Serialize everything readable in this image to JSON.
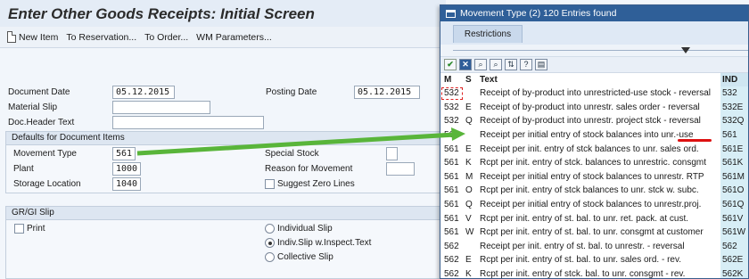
{
  "screen": {
    "title": "Enter Other Goods Receipts: Initial Screen",
    "toolbar": {
      "new_item": "New Item",
      "to_reservation": "To Reservation...",
      "to_order": "To Order...",
      "wm_parameters": "WM Parameters..."
    },
    "header_fields": {
      "document_date_label": "Document Date",
      "document_date_value": "05.12.2015",
      "posting_date_label": "Posting Date",
      "posting_date_value": "05.12.2015",
      "material_slip_label": "Material Slip",
      "material_slip_value": "",
      "doc_header_text_label": "Doc.Header Text",
      "doc_header_text_value": ""
    },
    "defaults": {
      "title": "Defaults for Document Items",
      "movement_type_label": "Movement Type",
      "movement_type_value": "561",
      "plant_label": "Plant",
      "plant_value": "1000",
      "storage_location_label": "Storage Location",
      "storage_location_value": "1040",
      "special_stock_label": "Special Stock",
      "special_stock_value": "",
      "reason_label": "Reason for Movement",
      "reason_value": "",
      "suggest_zero_lines_label": "Suggest Zero Lines"
    },
    "gr_gi_slip": {
      "title": "GR/GI Slip",
      "print_label": "Print",
      "individual_slip": "Individual Slip",
      "indiv_slip_inspect": "Indiv.Slip w.Inspect.Text",
      "collective_slip": "Collective Slip",
      "selected": "indiv_slip_inspect"
    }
  },
  "popup": {
    "title": "Movement Type (2)  120 Entries found",
    "tab": "Restrictions",
    "columns": [
      "M",
      "S",
      "Text",
      "IND"
    ],
    "rows": [
      {
        "m": "532",
        "s": "",
        "text": "Receipt of by-product into unrestricted-use stock - reversal",
        "ind": "532"
      },
      {
        "m": "532",
        "s": "E",
        "text": "Receipt of by-product into unrestr. sales order - reversal",
        "ind": "532E"
      },
      {
        "m": "532",
        "s": "Q",
        "text": "Receipt of by-product into unrestr. project stck - reversal",
        "ind": "532Q"
      },
      {
        "m": "561",
        "s": "",
        "text": "Receipt per initial entry of stock balances into unr.-use",
        "ind": "561"
      },
      {
        "m": "561",
        "s": "E",
        "text": "Receipt per init. entry of stck balances to unr. sales ord.",
        "ind": "561E"
      },
      {
        "m": "561",
        "s": "K",
        "text": "Rcpt per init. entry of stck. balances to unrestric. consgmt",
        "ind": "561K"
      },
      {
        "m": "561",
        "s": "M",
        "text": "Receipt per initial entry of stock balances to unrestr. RTP",
        "ind": "561M"
      },
      {
        "m": "561",
        "s": "O",
        "text": "Rcpt per init. entry of stck balances to unr. stck w. subc.",
        "ind": "561O"
      },
      {
        "m": "561",
        "s": "Q",
        "text": "Receipt per initial entry of stock balances to unrestr.proj.",
        "ind": "561Q"
      },
      {
        "m": "561",
        "s": "V",
        "text": "Rcpt per init. entry of st. bal. to unr. ret. pack. at cust.",
        "ind": "561V"
      },
      {
        "m": "561",
        "s": "W",
        "text": "Rcpt per init. entry of st. bal. to unr. consgmt at customer",
        "ind": "561W"
      },
      {
        "m": "562",
        "s": "",
        "text": "Receipt per init. entry of st. bal. to unrestr. - reversal",
        "ind": "562"
      },
      {
        "m": "562",
        "s": "E",
        "text": "Rcpt per init. entry of st. bal. to unr. sales ord. - rev.",
        "ind": "562E"
      },
      {
        "m": "562",
        "s": "K",
        "text": "Rcpt per init. entry of stck. bal. to unr. consgmt - rev.",
        "ind": "562K"
      }
    ]
  },
  "colors": {
    "title_bg": "#e4ecf6",
    "popup_title_bg": "#2f5f98",
    "ind_column_bg": "#d7eef6",
    "arrow": "#59b53a",
    "highlight": "#d11"
  }
}
